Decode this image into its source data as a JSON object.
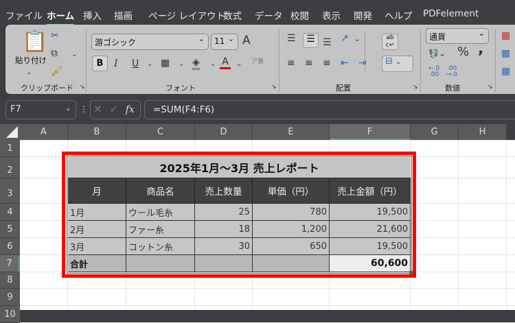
{
  "menu": {
    "tabs": [
      "ファイル",
      "ホーム",
      "挿入",
      "描画",
      "ページ レイアウト",
      "数式",
      "データ",
      "校閲",
      "表示",
      "開発",
      "ヘルプ",
      "PDFelement"
    ],
    "active": "ホーム"
  },
  "ribbon": {
    "clipboard": {
      "paste": "貼り付け",
      "label": "クリップボード"
    },
    "font": {
      "name": "游ゴシック",
      "size": "11",
      "label": "フォント",
      "bold": "B",
      "italic": "I",
      "underline": "U",
      "grow": "A",
      "shrink": "A",
      "font_color": "#e00000"
    },
    "alignment": {
      "label": "配置"
    },
    "number": {
      "format": "通貨",
      "label": "数値",
      "percent": "%",
      "comma": ","
    }
  },
  "formula_bar": {
    "name_box": "F7",
    "formula": "=SUM(F4:F6)",
    "fx": "fx"
  },
  "columns": [
    "A",
    "B",
    "C",
    "D",
    "E",
    "F",
    "G",
    "H"
  ],
  "rows": [
    "1",
    "2",
    "3",
    "4",
    "5",
    "6",
    "7",
    "8",
    "9",
    "10"
  ],
  "selected_cell": "F7",
  "highlight_color": "#ff0000",
  "table": {
    "title": "2025年1月～3月 売上レポート",
    "headers": [
      "月",
      "商品名",
      "売上数量",
      "単価（円）",
      "売上金額（円）"
    ],
    "rows": [
      [
        "1月",
        "ウール毛糸",
        "25",
        "780",
        "19,500"
      ],
      [
        "2月",
        "ファー糸",
        "18",
        "1,200",
        "21,600"
      ],
      [
        "3月",
        "コットン糸",
        "30",
        "650",
        "19,500"
      ]
    ],
    "total": {
      "label": "合計",
      "value": "60,600"
    }
  }
}
